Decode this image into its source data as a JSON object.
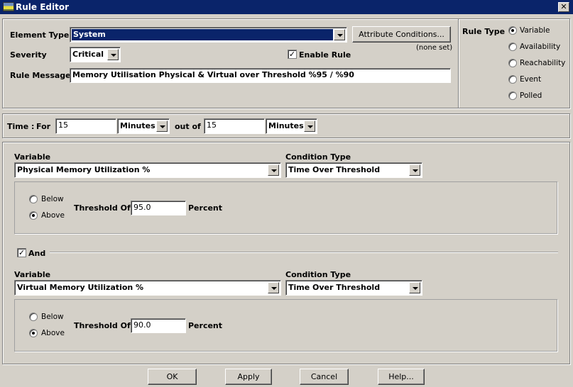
{
  "window": {
    "title": "Rule Editor",
    "close": "✕"
  },
  "top": {
    "element_type_label": "Element Type",
    "element_type_value": "System",
    "severity_label": "Severity",
    "severity_value": "Critical",
    "enable_rule_label": "Enable Rule",
    "enable_rule_checked": true,
    "attribute_conditions_button": "Attribute Conditions...",
    "attribute_conditions_status": "(none set)",
    "rule_message_label": "Rule Message",
    "rule_message_value": "Memory Utilisation Physical & Virtual over Threshold %95 / %90"
  },
  "rule_type": {
    "label": "Rule Type",
    "options": [
      "Variable",
      "Availability",
      "Reachability",
      "Event",
      "Polled"
    ],
    "selected": "Variable"
  },
  "time": {
    "label": "Time :",
    "for_label": "For",
    "for_value": "15",
    "for_unit": "Minutes",
    "out_of_label": "out of",
    "out_of_value": "15",
    "out_of_unit": "Minutes"
  },
  "conditions": [
    {
      "variable_label": "Variable",
      "variable_value": "Physical Memory Utilization %",
      "condition_type_label": "Condition Type",
      "condition_type_value": "Time Over Threshold",
      "below_label": "Below",
      "above_label": "Above",
      "selected": "Above",
      "threshold_label": "Threshold Of",
      "threshold_value": "95.0",
      "unit": "Percent"
    },
    {
      "variable_label": "Variable",
      "variable_value": "Virtual Memory Utilization %",
      "condition_type_label": "Condition Type",
      "condition_type_value": "Time Over Threshold",
      "below_label": "Below",
      "above_label": "Above",
      "selected": "Above",
      "threshold_label": "Threshold Of",
      "threshold_value": "90.0",
      "unit": "Percent"
    }
  ],
  "and": {
    "label": "And",
    "checked": true,
    "mark": "✓"
  },
  "buttons": {
    "ok": "OK",
    "apply": "Apply",
    "cancel": "Cancel",
    "help": "Help..."
  }
}
